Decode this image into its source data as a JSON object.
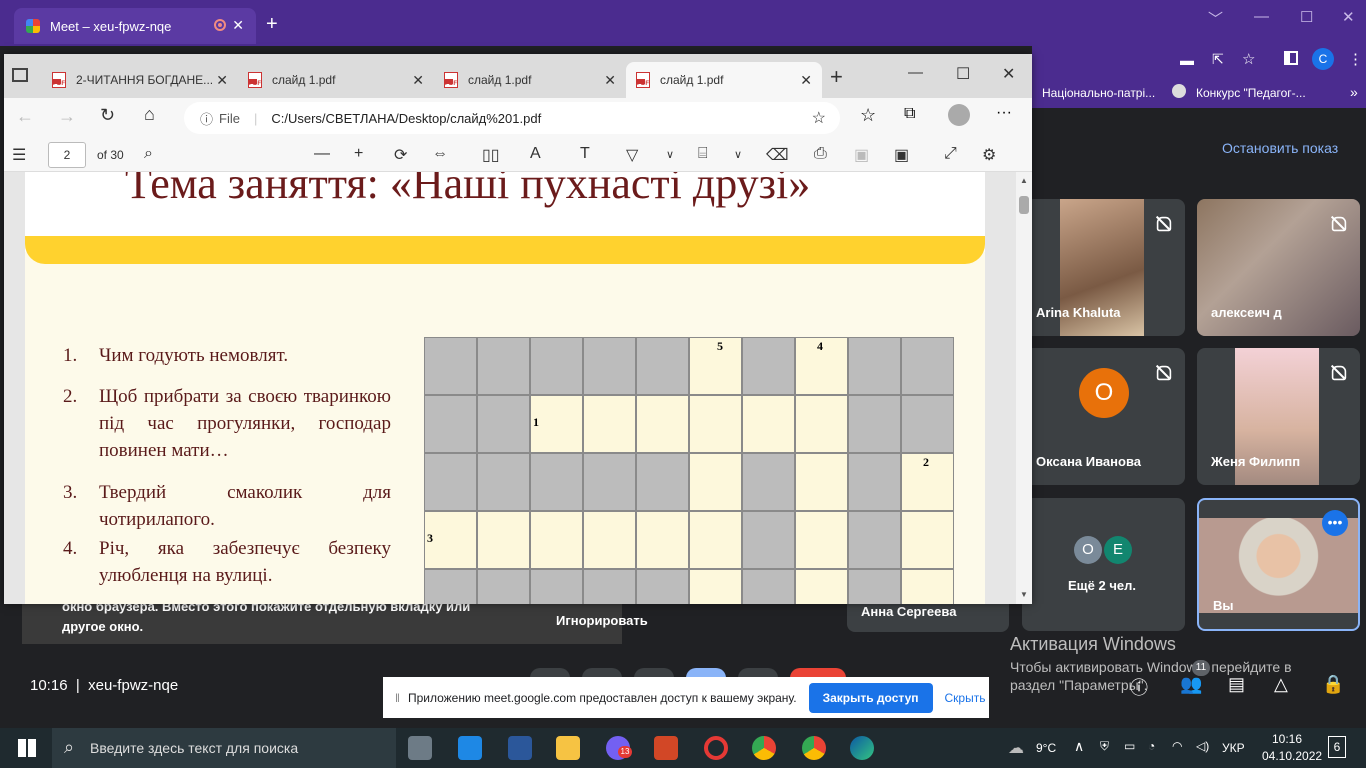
{
  "chrome": {
    "tab_title": "Meet – xeu-fpwz-nqe",
    "bookmarks": [
      "Національно-патрі...",
      "Конкурс \"Педагог-..."
    ],
    "profile_initial": "C"
  },
  "edge": {
    "tabs": [
      "2-ЧИТАННЯ БОГДАНЕ...",
      "слайд 1.pdf",
      "слайд 1.pdf",
      "слайд 1.pdf"
    ],
    "address_label": "File",
    "address": "C:/Users/СВЕТЛАНА/Desktop/слайд%201.pdf",
    "page_current": "2",
    "page_total": "of 30"
  },
  "slide": {
    "title": "Тема заняття: «Наші пухнасті друзі»",
    "questions": [
      {
        "n": "1.",
        "text": "Чим годують немовлят."
      },
      {
        "n": "2.",
        "text": "Щоб прибрати за своєю тваринкою під час прогулянки, господар повинен мати…"
      },
      {
        "n": "3.",
        "text": "Твердий смаколик для чотирилапого."
      },
      {
        "n": "4.",
        "text": "Річ, яка забезпечує безпеку улюбленця на вулиці."
      }
    ],
    "clue_numbers": [
      "5",
      "4",
      "1",
      "2",
      "3"
    ]
  },
  "meet": {
    "stop_presenting": "Остановить показ",
    "participants": [
      {
        "name": "Arina Khaluta"
      },
      {
        "name": "алексеич д"
      },
      {
        "name": "Оксана Иванова",
        "initial": "О"
      },
      {
        "name": "Женя Филипп"
      },
      {
        "name": "Ещё 2 чел.",
        "initials": [
          "O",
          "E"
        ]
      },
      {
        "name": "Вы"
      }
    ],
    "hidden_name": "Анна Сергеева",
    "warning_text_1": "окно браузера. Вместо этого покажите отдельную вкладку или",
    "warning_text_2": "другое окно.",
    "ignore": "Игнорировать",
    "time": "10:16",
    "meeting_code": "xeu-fpwz-nqe",
    "people_count": "11",
    "share_banner": "Приложению meet.google.com предоставлен доступ к вашему экрану.",
    "share_stop": "Закрыть доступ",
    "share_hide": "Скрыть",
    "activation_title": "Активация Windows",
    "activation_text_1": "Чтобы активировать Windows, перейдите в",
    "activation_text_2": "раздел \"Параметры\"."
  },
  "taskbar": {
    "search_placeholder": "Введите здесь текст для поиска",
    "weather": "9°C",
    "lang": "УКР",
    "clock_time": "10:16",
    "clock_date": "04.10.2022",
    "notif_count": "6",
    "viber_badge": "13"
  }
}
